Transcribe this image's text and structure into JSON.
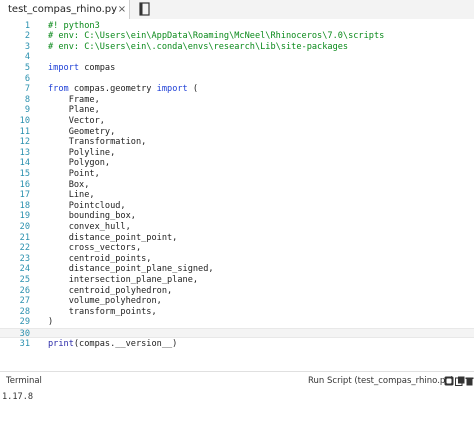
{
  "tabs": [
    {
      "label": "test_compas_rhino.py",
      "close_glyph": "×"
    }
  ],
  "editor": {
    "lines": [
      {
        "n": "1",
        "parts": [
          {
            "t": "#! python3",
            "c": "cmt"
          }
        ]
      },
      {
        "n": "2",
        "parts": [
          {
            "t": "# env: C:\\Users\\ein\\AppData\\Roaming\\McNeel\\Rhinoceros\\7.0\\scripts",
            "c": "cmt"
          }
        ]
      },
      {
        "n": "3",
        "parts": [
          {
            "t": "# env: C:\\Users\\ein\\.conda\\envs\\research\\Lib\\site-packages",
            "c": "cmt"
          }
        ]
      },
      {
        "n": "4",
        "parts": []
      },
      {
        "n": "5",
        "parts": [
          {
            "t": "import",
            "c": "kw"
          },
          {
            "t": " compas",
            "c": ""
          }
        ]
      },
      {
        "n": "6",
        "parts": []
      },
      {
        "n": "7",
        "parts": [
          {
            "t": "from",
            "c": "kw"
          },
          {
            "t": " compas.geometry ",
            "c": ""
          },
          {
            "t": "import",
            "c": "kw"
          },
          {
            "t": " (",
            "c": ""
          }
        ]
      },
      {
        "n": "8",
        "parts": [
          {
            "t": "    Frame,",
            "c": ""
          }
        ]
      },
      {
        "n": "9",
        "parts": [
          {
            "t": "    Plane,",
            "c": ""
          }
        ]
      },
      {
        "n": "10",
        "parts": [
          {
            "t": "    Vector,",
            "c": ""
          }
        ]
      },
      {
        "n": "11",
        "parts": [
          {
            "t": "    Geometry,",
            "c": ""
          }
        ]
      },
      {
        "n": "12",
        "parts": [
          {
            "t": "    Transformation,",
            "c": ""
          }
        ]
      },
      {
        "n": "13",
        "parts": [
          {
            "t": "    Polyline,",
            "c": ""
          }
        ]
      },
      {
        "n": "14",
        "parts": [
          {
            "t": "    Polygon,",
            "c": ""
          }
        ]
      },
      {
        "n": "15",
        "parts": [
          {
            "t": "    Point,",
            "c": ""
          }
        ]
      },
      {
        "n": "16",
        "parts": [
          {
            "t": "    Box,",
            "c": ""
          }
        ]
      },
      {
        "n": "17",
        "parts": [
          {
            "t": "    Line,",
            "c": ""
          }
        ]
      },
      {
        "n": "18",
        "parts": [
          {
            "t": "    Pointcloud,",
            "c": ""
          }
        ]
      },
      {
        "n": "19",
        "parts": [
          {
            "t": "    bounding_box,",
            "c": ""
          }
        ]
      },
      {
        "n": "20",
        "parts": [
          {
            "t": "    convex_hull,",
            "c": ""
          }
        ]
      },
      {
        "n": "21",
        "parts": [
          {
            "t": "    distance_point_point,",
            "c": ""
          }
        ]
      },
      {
        "n": "22",
        "parts": [
          {
            "t": "    cross_vectors,",
            "c": ""
          }
        ]
      },
      {
        "n": "23",
        "parts": [
          {
            "t": "    centroid_points,",
            "c": ""
          }
        ]
      },
      {
        "n": "24",
        "parts": [
          {
            "t": "    distance_point_plane_signed,",
            "c": ""
          }
        ]
      },
      {
        "n": "25",
        "parts": [
          {
            "t": "    intersection_plane_plane,",
            "c": ""
          }
        ]
      },
      {
        "n": "26",
        "parts": [
          {
            "t": "    centroid_polyhedron,",
            "c": ""
          }
        ]
      },
      {
        "n": "27",
        "parts": [
          {
            "t": "    volume_polyhedron,",
            "c": ""
          }
        ]
      },
      {
        "n": "28",
        "parts": [
          {
            "t": "    transform_points,",
            "c": ""
          }
        ]
      },
      {
        "n": "29",
        "parts": [
          {
            "t": ")",
            "c": ""
          }
        ]
      },
      {
        "n": "30",
        "parts": [],
        "active": true
      },
      {
        "n": "31",
        "parts": [
          {
            "t": "print",
            "c": "fn"
          },
          {
            "t": "(compas.__version__)",
            "c": ""
          }
        ]
      }
    ]
  },
  "terminal": {
    "title": "Terminal",
    "run_label": "Run Script (test_compas_rhino.py)",
    "output": "1.17.8",
    "icons": [
      "clear-terminal-icon",
      "copy-icon",
      "trash-icon"
    ]
  },
  "colors": {
    "comment": "#0b8a1b",
    "keyword": "#1e3fd6",
    "line_number": "#2b91af"
  }
}
